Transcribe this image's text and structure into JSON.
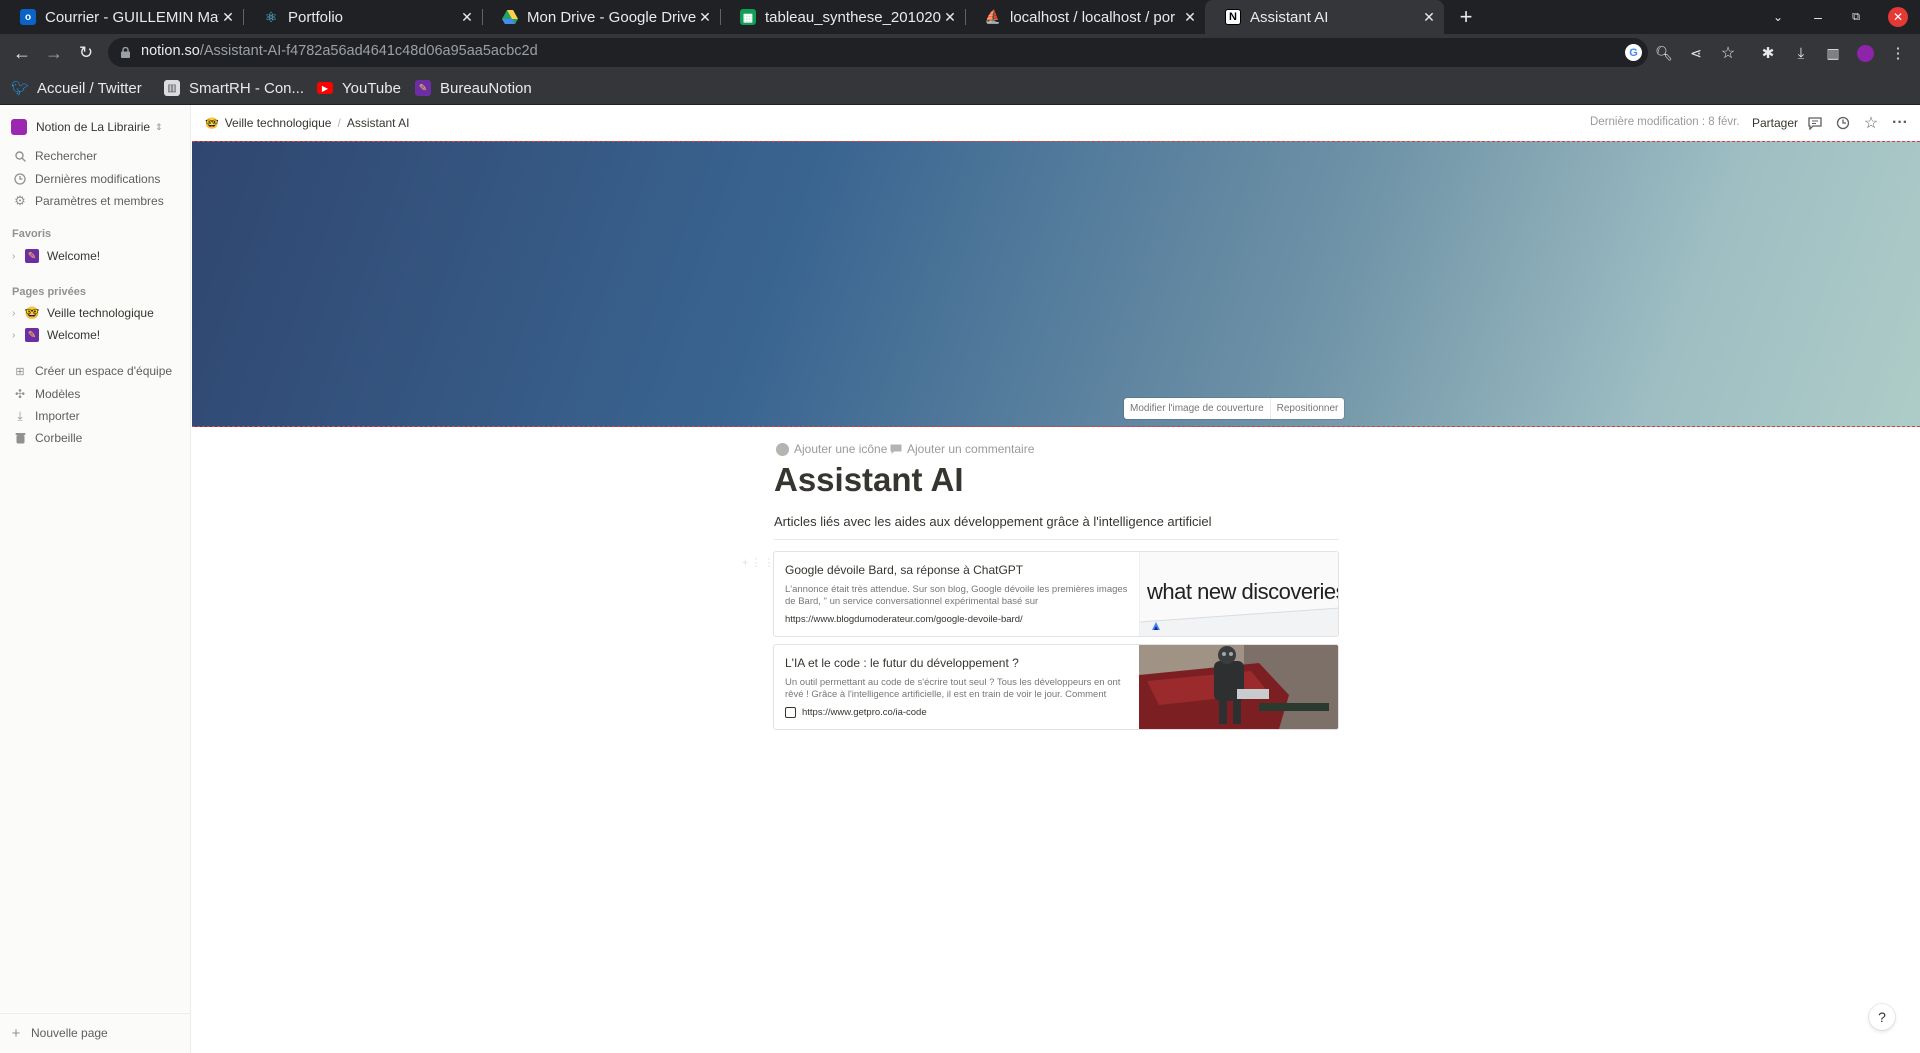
{
  "browser": {
    "tabs": [
      {
        "label": "Courrier - GUILLEMIN Mat",
        "icon": "outlook-icon"
      },
      {
        "label": "Portfolio",
        "icon": "react-icon"
      },
      {
        "label": "Mon Drive - Google Drive",
        "icon": "google-drive-icon"
      },
      {
        "label": "tableau_synthese_201020",
        "icon": "google-sheets-icon"
      },
      {
        "label": "localhost / localhost / por",
        "icon": "phpmyadmin-icon"
      },
      {
        "label": "Assistant AI",
        "icon": "notion-icon",
        "active": true
      }
    ],
    "url": {
      "domain": "notion.so",
      "path": "/Assistant-AI-f4782a56ad4641c48d06a95aa5acbc2d"
    },
    "bookmarks": [
      {
        "label": "Accueil / Twitter",
        "icon": "twitter-icon"
      },
      {
        "label": "SmartRH - Con...",
        "icon": "smartrh-icon"
      },
      {
        "label": "YouTube",
        "icon": "youtube-icon"
      },
      {
        "label": "BureauNotion",
        "icon": "bureaunotion-icon"
      }
    ],
    "colors": {
      "tabbar": "#202124",
      "toolbar": "#35363a",
      "close": "#e53935"
    }
  },
  "sidebar": {
    "workspace": "Notion de La Librairie",
    "top_items": [
      {
        "label": "Rechercher",
        "icon": "search-icon"
      },
      {
        "label": "Dernières modifications",
        "icon": "clock-icon"
      },
      {
        "label": "Paramètres et membres",
        "icon": "gear-icon"
      }
    ],
    "favorites_heading": "Favoris",
    "favorites": [
      {
        "label": "Welcome!",
        "icon": "welcome-page-icon"
      }
    ],
    "private_heading": "Pages privées",
    "private_pages": [
      {
        "label": "Veille technologique",
        "icon": "nerd-face-icon"
      },
      {
        "label": "Welcome!",
        "icon": "welcome-page-icon"
      }
    ],
    "bottom_items": [
      {
        "label": "Créer un espace d'équipe",
        "icon": "team-space-icon"
      },
      {
        "label": "Modèles",
        "icon": "templates-icon"
      },
      {
        "label": "Importer",
        "icon": "import-icon"
      },
      {
        "label": "Corbeille",
        "icon": "trash-icon"
      }
    ],
    "new_page": "Nouvelle page"
  },
  "topbar": {
    "breadcrumb": [
      "Veille technologique",
      "Assistant AI"
    ],
    "last_modified": "Dernière modification : 8 févr.",
    "share": "Partager"
  },
  "cover": {
    "change_label": "Modifier l'image de couverture",
    "reposition_label": "Repositionner"
  },
  "page": {
    "add_icon": "Ajouter une icône",
    "add_comment": "Ajouter un commentaire",
    "title": "Assistant AI",
    "description": "Articles liés avec les aides aux développement grâce à l'intelligence artificiel",
    "bookmarks": [
      {
        "title": "Google dévoile Bard, sa réponse à ChatGPT",
        "description": "L'annonce était très attendue. Sur son blog, Google dévoile les premières images de Bard, \" un service conversationnel expérimental basé sur",
        "url": "https://www.blogdumoderateur.com/google-devoile-bard/",
        "thumb_text": "what new discoveries"
      },
      {
        "title": "L'IA et le code : le futur du développement ?",
        "description": "Un outil permettant au code de s'écrire tout seul ? Tous les développeurs en ont rêvé ! Grâce à l'intelligence artificielle, il est en train de voir le jour. Comment",
        "url": "https://www.getpro.co/ia-code"
      }
    ]
  },
  "help": "?"
}
